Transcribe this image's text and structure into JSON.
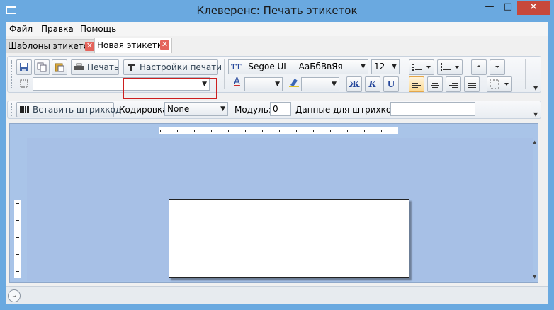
{
  "window": {
    "title": "Клеверенс: Печать этикеток",
    "min_glyph": "—",
    "max_glyph": "□",
    "close_glyph": "✕"
  },
  "menu": {
    "items": [
      "Файл",
      "Правка",
      "Помощь"
    ]
  },
  "tabs": [
    {
      "label": "Шаблоны этикеток",
      "active": false
    },
    {
      "label": "Новая этикетка",
      "active": true
    }
  ],
  "tab_close_glyph": "✕",
  "toolbar": {
    "print_label": "Печать",
    "print_settings_label": "Настройки печати",
    "font_name": "Segoe UI",
    "font_sample": "АаБбВвЯя",
    "font_size": "12",
    "bold_label": "Ж",
    "italic_label": "К",
    "underline_label": "U",
    "dropdown_glyph": "▼",
    "font_icon_glyph": "TT",
    "font_color_glyph": "A"
  },
  "barcode_bar": {
    "insert_label": "Вставить штрихкод",
    "encoding_label": "Кодировка:",
    "encoding_value": "None",
    "module_label": "Модуль:",
    "module_value": "0",
    "data_label": "Данные для штрихкода:",
    "data_value": ""
  },
  "status": {
    "expand_glyph": "⌄"
  },
  "colors": {
    "title_bar": "#6aa9e0",
    "close_button": "#c7483b",
    "highlight_border": "#cc1f1f",
    "design_surface": "#a9c4e8"
  }
}
